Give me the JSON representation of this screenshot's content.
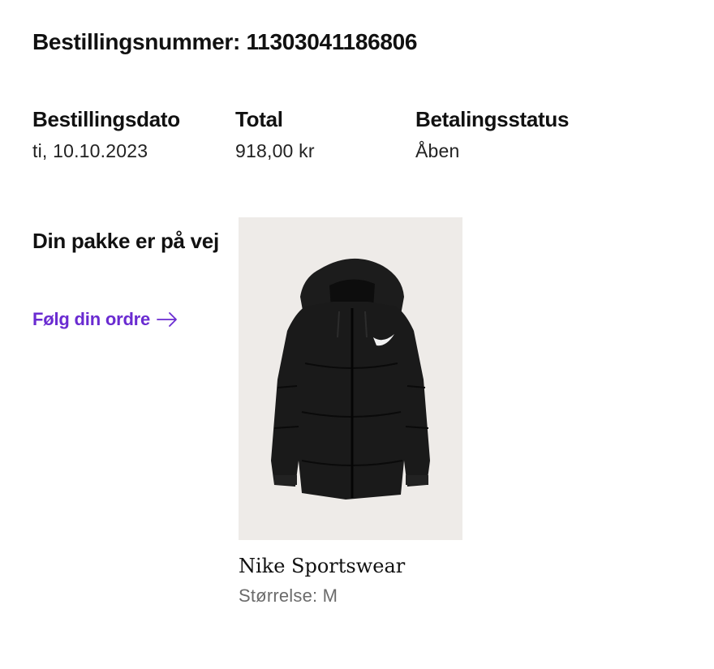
{
  "order": {
    "title": "Bestillingsnummer: 11303041186806"
  },
  "meta": {
    "date_label": "Bestillingsdato",
    "date_value": "ti, 10.10.2023",
    "total_label": "Total",
    "total_value": "918,00 kr",
    "payment_label": "Betalingsstatus",
    "payment_value": "Åben"
  },
  "shipment": {
    "status": "Din pakke er på vej",
    "track_label": "Følg din ordre",
    "track_icon": "arrow-right-icon",
    "link_color": "#6a2bd1"
  },
  "product": {
    "brand": "Nike Sportswear",
    "size": "Størrelse: M",
    "image_bg": "#eeebe8"
  }
}
